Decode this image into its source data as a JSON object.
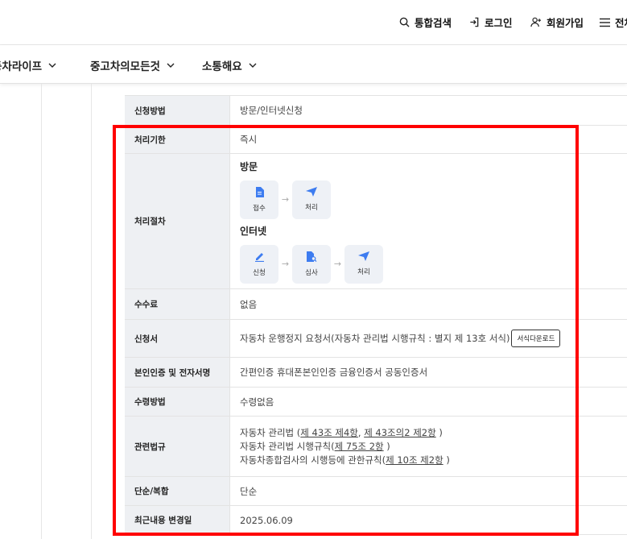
{
  "header": {
    "search": "통합검색",
    "login": "로그인",
    "join": "회원가입",
    "menu": "전체"
  },
  "nav": [
    "동차라이프",
    "중고차의모든것",
    "소통해요"
  ],
  "rows": {
    "method": {
      "label": "신청방법",
      "value": "방문/인터넷신청"
    },
    "deadline": {
      "label": "처리기한",
      "value": "즉시"
    },
    "procedure": {
      "label": "처리절차",
      "visit_title": "방문",
      "visit_steps": [
        "접수",
        "처리"
      ],
      "online_title": "인터넷",
      "online_steps": [
        "신청",
        "심사",
        "처리"
      ]
    },
    "fee": {
      "label": "수수료",
      "value": "없음"
    },
    "form": {
      "label": "신청서",
      "value": "자동차 운행정지 요청서(자동차 관리법 시행규칙 : 별지 제 13호 서식)",
      "download": "서식다운로드"
    },
    "auth": {
      "label": "본인인증 및 전자서명",
      "value": "간편인증 휴대폰본인인증 금융인증서 공동인증서"
    },
    "receive": {
      "label": "수령방법",
      "value": "수령없음"
    },
    "law": {
      "label": "관련법규",
      "l1_pre": "자동차 관리법 (",
      "l1_a": "제 43조 제4항",
      "l1_sep": ", ",
      "l1_b": "제 43조의2 제2항",
      "l1_post": " )",
      "l2_pre": "자동차 관리법 시행규칙(",
      "l2_a": "제 75조 2항",
      "l2_post": " )",
      "l3_pre": "자동차종합검사의 시행등에 관한규칙(",
      "l3_a": "제 10조 제2항",
      "l3_post": " )"
    },
    "type": {
      "label": "단순/복합",
      "value": "단순"
    },
    "updated": {
      "label": "최근내용 변경일",
      "value": "2025.06.09"
    }
  },
  "colors": {
    "highlight": "#ff0000",
    "header_bg": "#eef0f3",
    "step_icon": "#3d7cf0"
  }
}
